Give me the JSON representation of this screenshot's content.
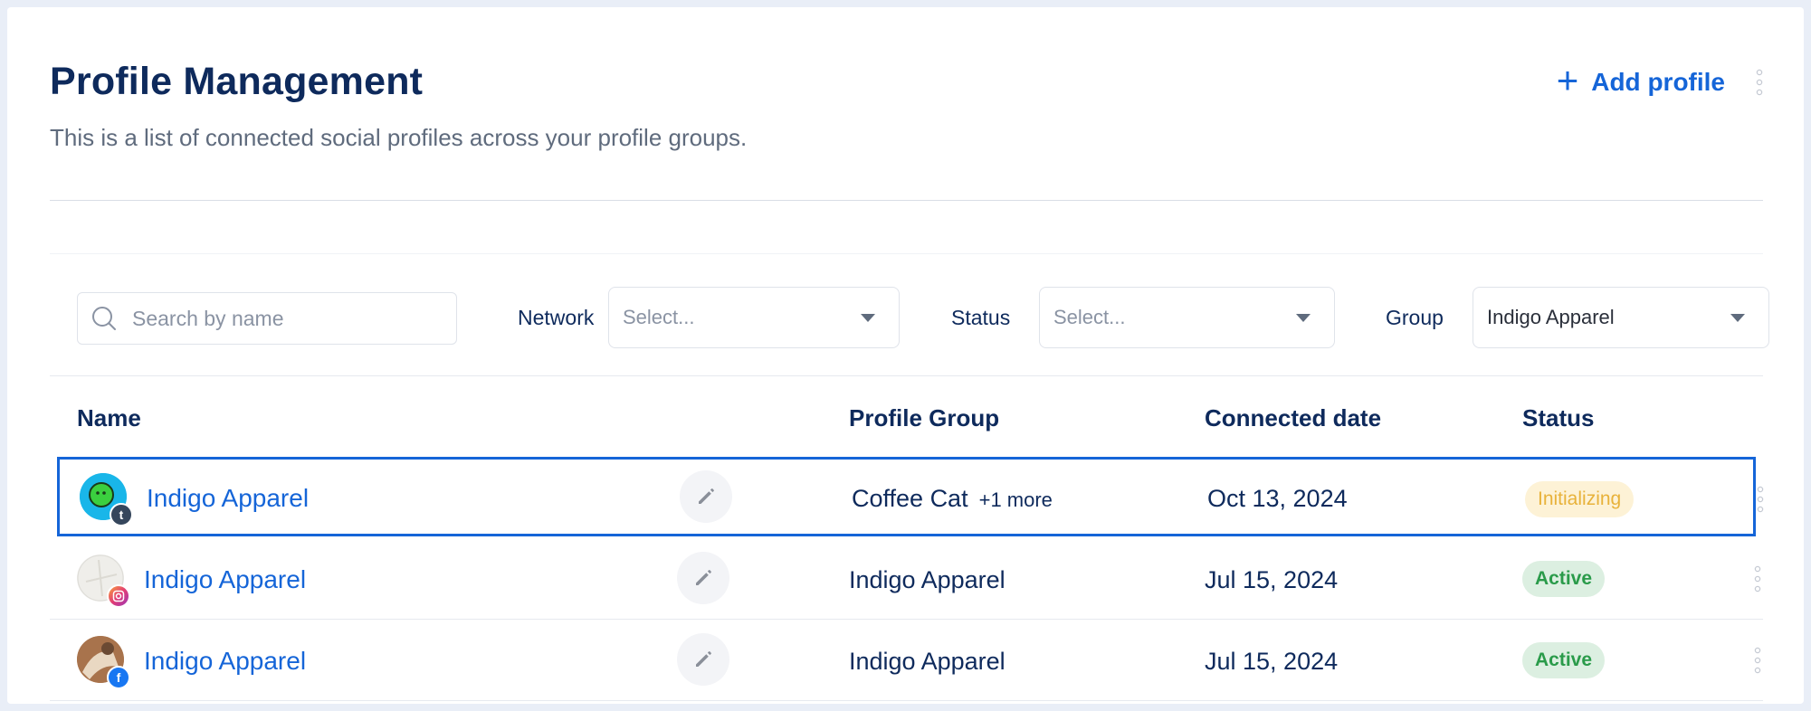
{
  "header": {
    "title": "Profile Management",
    "subtitle": "This is a list of connected social profiles across your profile groups.",
    "add_label": "Add profile"
  },
  "filters": {
    "search_placeholder": "Search by name",
    "network_label": "Network",
    "network_value": "Select...",
    "status_label": "Status",
    "status_value": "Select...",
    "group_label": "Group",
    "group_value": "Indigo Apparel"
  },
  "table": {
    "columns": [
      "Name",
      "Profile Group",
      "Connected date",
      "Status"
    ],
    "rows": [
      {
        "name": "Indigo Apparel",
        "network": "tumblr",
        "group": "Coffee Cat",
        "more": "+1 more",
        "date": "Oct 13, 2024",
        "status": "Initializing"
      },
      {
        "name": "Indigo Apparel",
        "network": "instagram",
        "group": "Indigo Apparel",
        "more": "",
        "date": "Jul 15, 2024",
        "status": "Active"
      },
      {
        "name": "Indigo Apparel",
        "network": "facebook",
        "group": "Indigo Apparel",
        "more": "",
        "date": "Jul 15, 2024",
        "status": "Active"
      }
    ]
  },
  "colors": {
    "accent": "#1565d8",
    "title": "#0e2a5c",
    "initializing_bg": "#fdf2d6",
    "initializing_text": "#e8b23a",
    "active_bg": "#dcefe1",
    "active_text": "#2a9b4a"
  },
  "icons": [
    "plus-icon",
    "kebab-menu-icon",
    "search-icon",
    "chevron-down-icon",
    "pencil-icon",
    "tumblr-icon",
    "instagram-icon",
    "facebook-icon"
  ]
}
